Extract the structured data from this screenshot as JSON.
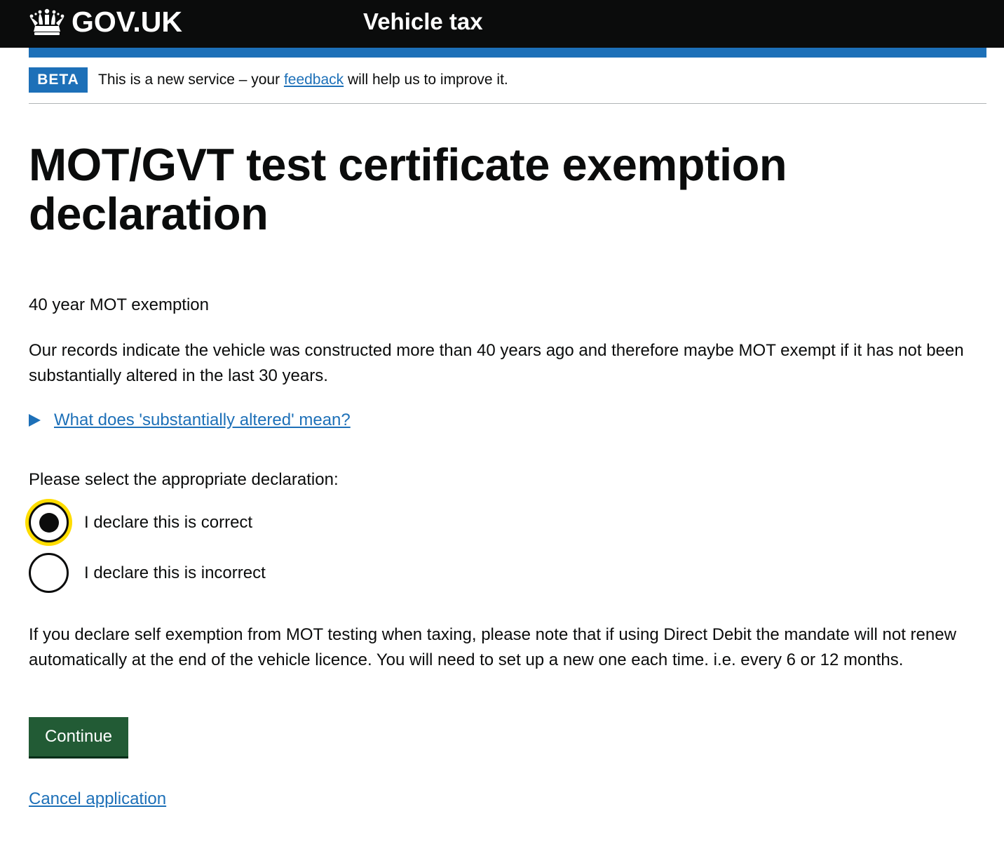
{
  "header": {
    "logo_text": "GOV.UK",
    "service_name": "Vehicle tax"
  },
  "phase_banner": {
    "tag": "BETA",
    "text_before": "This is a new service – your ",
    "link_text": "feedback",
    "text_after": " will help us to improve it."
  },
  "main": {
    "title": "MOT/GVT test certificate exemption declaration",
    "subtitle": "40 year MOT exemption",
    "intro": "Our records indicate the vehicle was constructed more than 40 years ago and therefore maybe MOT exempt if it has not been substantially altered in the last 30 years.",
    "details_summary": "What does 'substantially altered' mean?",
    "legend": "Please select the appropriate declaration:",
    "radios": [
      {
        "label": "I declare this is correct",
        "checked": true
      },
      {
        "label": "I declare this is incorrect",
        "checked": false
      }
    ],
    "note": "If you declare self exemption from MOT testing when taxing, please note that if using Direct Debit the mandate will not renew automatically at the end of the vehicle licence. You will need to set up a new one each time. i.e. every 6 or 12 months.",
    "continue_label": "Continue",
    "cancel_label": "Cancel application"
  },
  "colors": {
    "header_bg": "#0b0c0c",
    "link": "#1d70b8",
    "button": "#225b35",
    "focus": "#ffdd00"
  }
}
